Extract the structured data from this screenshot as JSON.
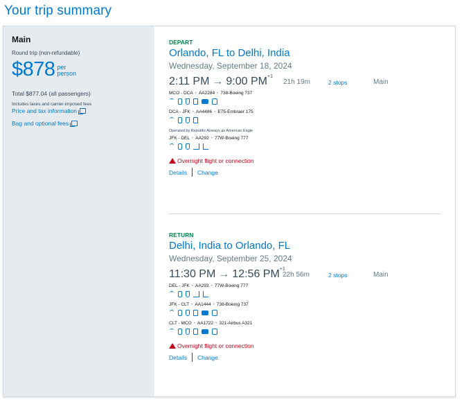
{
  "page": {
    "title": "Your trip summary"
  },
  "sidebar": {
    "fare_name": "Main",
    "trip_type": "Round trip (non-refundable)",
    "price": "$878",
    "per": "per",
    "person": "person",
    "total": "Total $877.04 (all passengers)",
    "includes": "Includes taxes and carrier-imposed fees",
    "price_tax_link": "Price and tax information",
    "bag_fees_link": "Bag and optional fees"
  },
  "depart": {
    "label": "DEPART",
    "route": "Orlando, FL to Delhi, India",
    "date": "Wednesday, September 18, 2024",
    "dep_time": "2:11 PM",
    "arrow": "→",
    "arr_time": "9:00 PM",
    "day_offset": "+1",
    "duration": "21h 19m",
    "stops": "2 stops",
    "cabin": "Main",
    "segments": [
      {
        "route": "MCO - DCA",
        "flight": "AA2284",
        "aircraft": "738-Boeing 737",
        "amenities": [
          "wifi-icon",
          "power-outlet-icon",
          "usb-icon",
          "device-entertainment-icon",
          "tv-icon",
          "app-entertainment-icon"
        ]
      },
      {
        "route": "DCA - JFK",
        "flight": "AA4486",
        "aircraft": "E75-Embraer 175",
        "amenities": [
          "wifi-icon",
          "power-outlet-icon",
          "usb-icon",
          "device-entertainment-icon"
        ],
        "operated_by": "Operated by Republic Airways as American Eagle"
      },
      {
        "route": "JFK - DEL",
        "flight": "AA292",
        "aircraft": "77W-Boeing 777",
        "amenities": [
          "wifi-icon",
          "power-outlet-icon",
          "usb-icon",
          "meal-icon",
          "lie-flat-seat-icon"
        ]
      }
    ],
    "overnight": "Overnight flight or connection",
    "details": "Details",
    "change": "Change"
  },
  "return": {
    "label": "RETURN",
    "route": "Delhi, India to Orlando, FL",
    "date": "Wednesday, September 25, 2024",
    "dep_time": "11:30 PM",
    "arrow": "→",
    "arr_time": "12:56 PM",
    "day_offset": "+1",
    "duration": "22h 56m",
    "stops": "2 stops",
    "cabin": "Main",
    "segments": [
      {
        "route": "DEL - JFK",
        "flight": "AA293",
        "aircraft": "77W-Boeing 777",
        "amenities": [
          "wifi-icon",
          "power-outlet-icon",
          "usb-icon",
          "meal-icon",
          "lie-flat-seat-icon"
        ]
      },
      {
        "route": "JFK - CLT",
        "flight": "AA1444",
        "aircraft": "738-Boeing 737",
        "amenities": [
          "wifi-icon",
          "power-outlet-icon",
          "usb-icon",
          "device-entertainment-icon",
          "tv-icon",
          "app-entertainment-icon"
        ]
      },
      {
        "route": "CLT - MCO",
        "flight": "AA1722",
        "aircraft": "321-Airbus A321",
        "amenities": [
          "wifi-icon",
          "power-outlet-icon",
          "usb-icon",
          "device-entertainment-icon",
          "tv-icon",
          "app-entertainment-icon"
        ]
      }
    ],
    "overnight": "Overnight flight or connection",
    "details": "Details",
    "change": "Change"
  },
  "colors": {
    "brand_blue": "#0078d2",
    "depart_green": "#00874e",
    "warning_red": "#c30019",
    "sidebar_bg": "#e5ebef"
  }
}
